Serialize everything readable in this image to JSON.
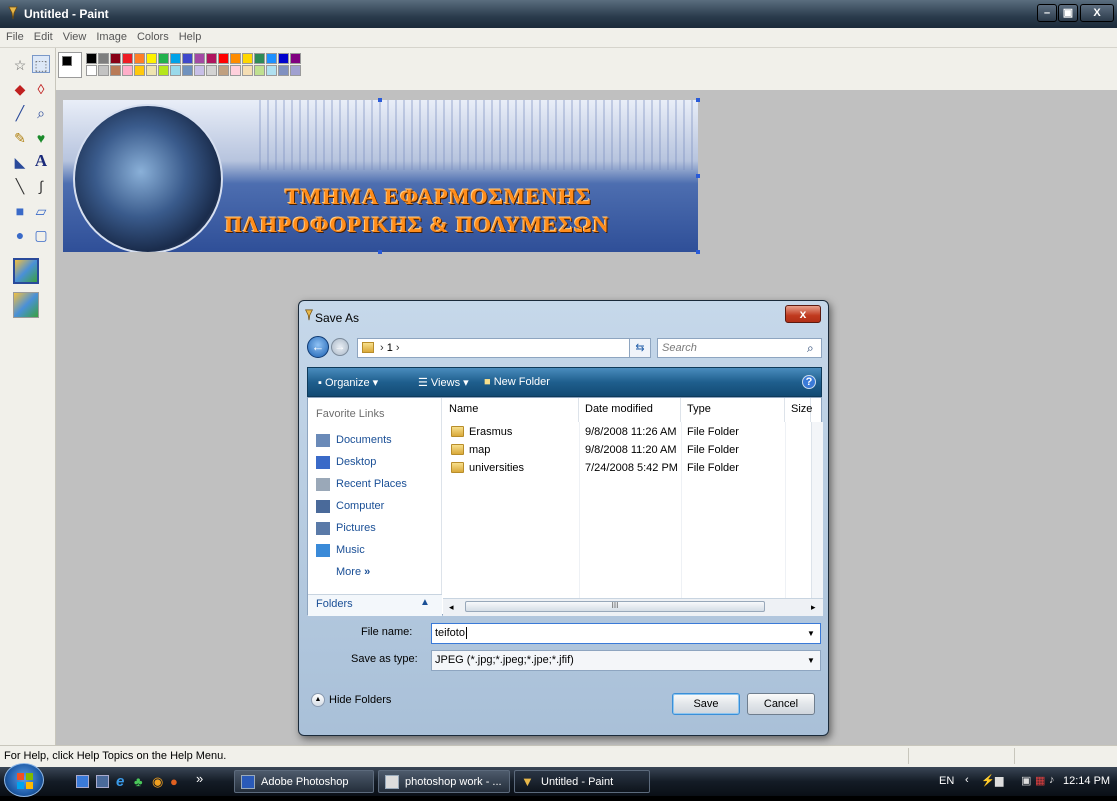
{
  "window": {
    "title": "Untitled - Paint",
    "controls": {
      "minimize": "–",
      "maximize": "▣",
      "close": "X"
    }
  },
  "menubar": [
    "File",
    "Edit",
    "View",
    "Image",
    "Colors",
    "Help"
  ],
  "palette": {
    "top_row": [
      "#000000",
      "#7f7f7f",
      "#880015",
      "#ed1c24",
      "#ff7f27",
      "#fff200",
      "#22b14c",
      "#00a2e8",
      "#3f48cc",
      "#a349a4",
      "#b0145e",
      "#ff0000",
      "#ff8c00",
      "#ffd700",
      "#2e8b57",
      "#1e90ff",
      "#0000cd",
      "#800080"
    ],
    "bottom_row": [
      "#ffffff",
      "#c3c3c3",
      "#b97a57",
      "#ffaec9",
      "#ffc90e",
      "#efe4b0",
      "#b5e61d",
      "#99d9ea",
      "#7092be",
      "#c8bfe7",
      "#d3d3d3",
      "#c0a080",
      "#ffd0dc",
      "#f5deb3",
      "#c0e090",
      "#b0e0f0",
      "#8090c0",
      "#a0a0d0"
    ],
    "primary": "#000000",
    "secondary": "#ffffff"
  },
  "banner": {
    "line1": "ΤΜΗΜΑ ΕΦΑΡΜΟΣΜΕΝΗΣ",
    "line2": "ΠΛΗΡΟΦΟΡΙΚΗΣ & ΠΟΛΥΜΕΣΩΝ"
  },
  "statusbar": {
    "text": "For Help, click Help Topics on the Help Menu."
  },
  "dialog": {
    "title": "Save As",
    "close": "x",
    "address": "1",
    "search_placeholder": "Search",
    "commands": {
      "organize": "Organize",
      "views": "Views",
      "new_folder": "New Folder",
      "help": "?"
    },
    "favorite_links_header": "Favorite Links",
    "favorites": [
      "Documents",
      "Desktop",
      "Recent Places",
      "Computer",
      "Pictures",
      "Music"
    ],
    "more": "More",
    "folders": "Folders",
    "columns": {
      "name": "Name",
      "date": "Date modified",
      "type": "Type",
      "size": "Size"
    },
    "files": [
      {
        "name": "Erasmus",
        "date": "9/8/2008 11:26 AM",
        "type": "File Folder"
      },
      {
        "name": "map",
        "date": "9/8/2008 11:20 AM",
        "type": "File Folder"
      },
      {
        "name": "universities",
        "date": "7/24/2008 5:42 PM",
        "type": "File Folder"
      }
    ],
    "scroll_thumb": "III",
    "file_name_label": "File name:",
    "file_name_value": "teifoto",
    "save_type_label": "Save as type:",
    "save_type_value": "JPEG (*.jpg;*.jpeg;*.jpe;*.jfif)",
    "hide_folders": "Hide Folders",
    "save": "Save",
    "cancel": "Cancel"
  },
  "taskbar": {
    "overflow": "»",
    "tasks": [
      "Adobe Photoshop",
      "photoshop work - ...",
      "Untitled - Paint"
    ],
    "lang": "EN",
    "time": "12:14 PM"
  }
}
